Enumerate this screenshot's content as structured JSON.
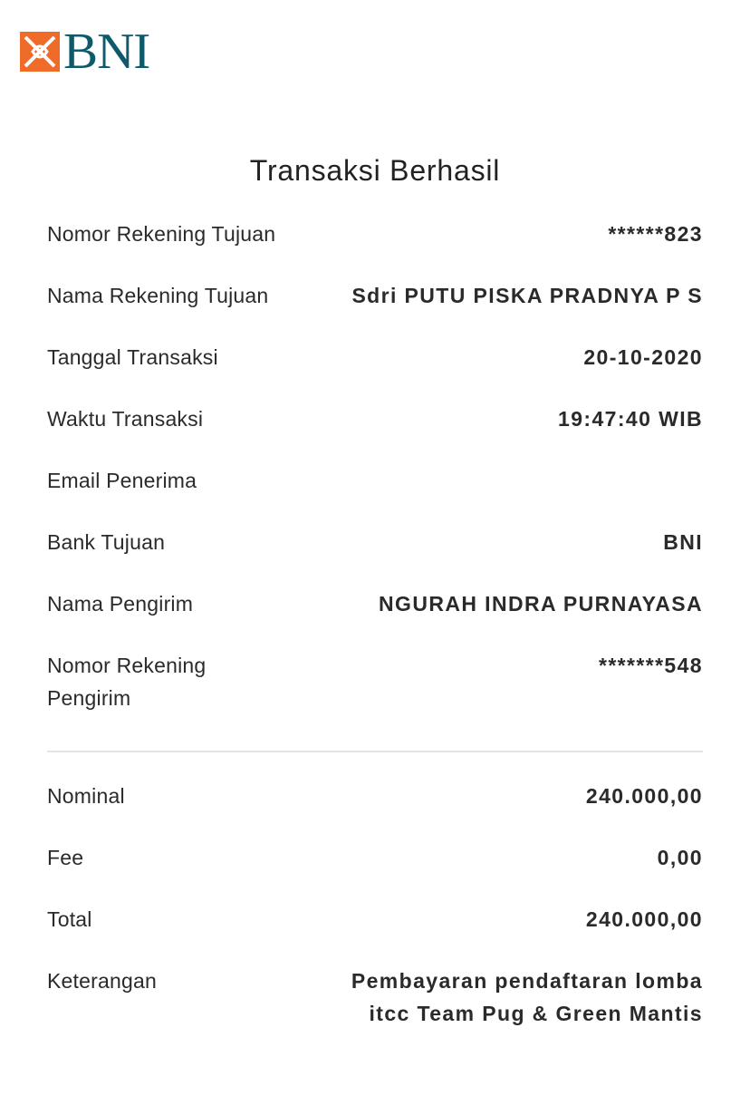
{
  "brand": {
    "name": "BNI",
    "colors": {
      "mark": "#ef6b2a",
      "text": "#0e5a6b"
    }
  },
  "title": "Transaksi Berhasil",
  "details": [
    {
      "label": "Nomor Rekening Tujuan",
      "value": "******823"
    },
    {
      "label": "Nama Rekening Tujuan",
      "value": "Sdri PUTU PISKA PRADNYA P S"
    },
    {
      "label": "Tanggal Transaksi",
      "value": "20-10-2020"
    },
    {
      "label": "Waktu Transaksi",
      "value": "19:47:40 WIB"
    },
    {
      "label": "Email Penerima",
      "value": ""
    },
    {
      "label": "Bank Tujuan",
      "value": "BNI"
    },
    {
      "label": "Nama Pengirim",
      "value": "NGURAH INDRA PURNAYASA"
    },
    {
      "label": "Nomor Rekening Pengirim",
      "value": "*******548"
    }
  ],
  "amounts": [
    {
      "label": "Nominal",
      "value": "240.000,00"
    },
    {
      "label": "Fee",
      "value": "0,00"
    },
    {
      "label": "Total",
      "value": "240.000,00"
    },
    {
      "label": "Keterangan",
      "value": "Pembayaran pendaftaran lomba itcc Team Pug & Green Mantis"
    }
  ]
}
